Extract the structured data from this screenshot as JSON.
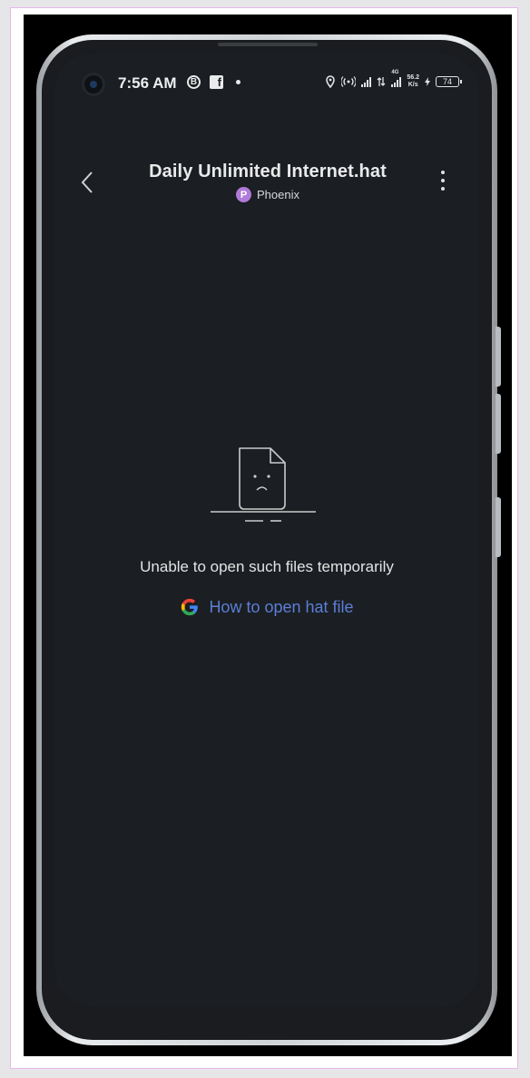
{
  "status_bar": {
    "time": "7:56 AM",
    "b_badge": "B",
    "fb_badge": "f",
    "network_type": "4G",
    "speed_value": "56.2",
    "speed_unit": "K/s",
    "battery": "74"
  },
  "header": {
    "title": "Daily Unlimited Internet.hat",
    "sender_initial": "P",
    "sender_name": "Phoenix"
  },
  "content": {
    "error_message": "Unable to open such files temporarily",
    "help_link_label": "How to open hat file"
  },
  "icons": {
    "back": "chevron-left-icon",
    "more": "more-vertical-icon",
    "empty_state": "sad-file-icon",
    "search_engine": "google-icon"
  },
  "colors": {
    "screen_bg": "#1b1e22",
    "link": "#5b7fd6",
    "sender_badge": "#b07ad8"
  }
}
